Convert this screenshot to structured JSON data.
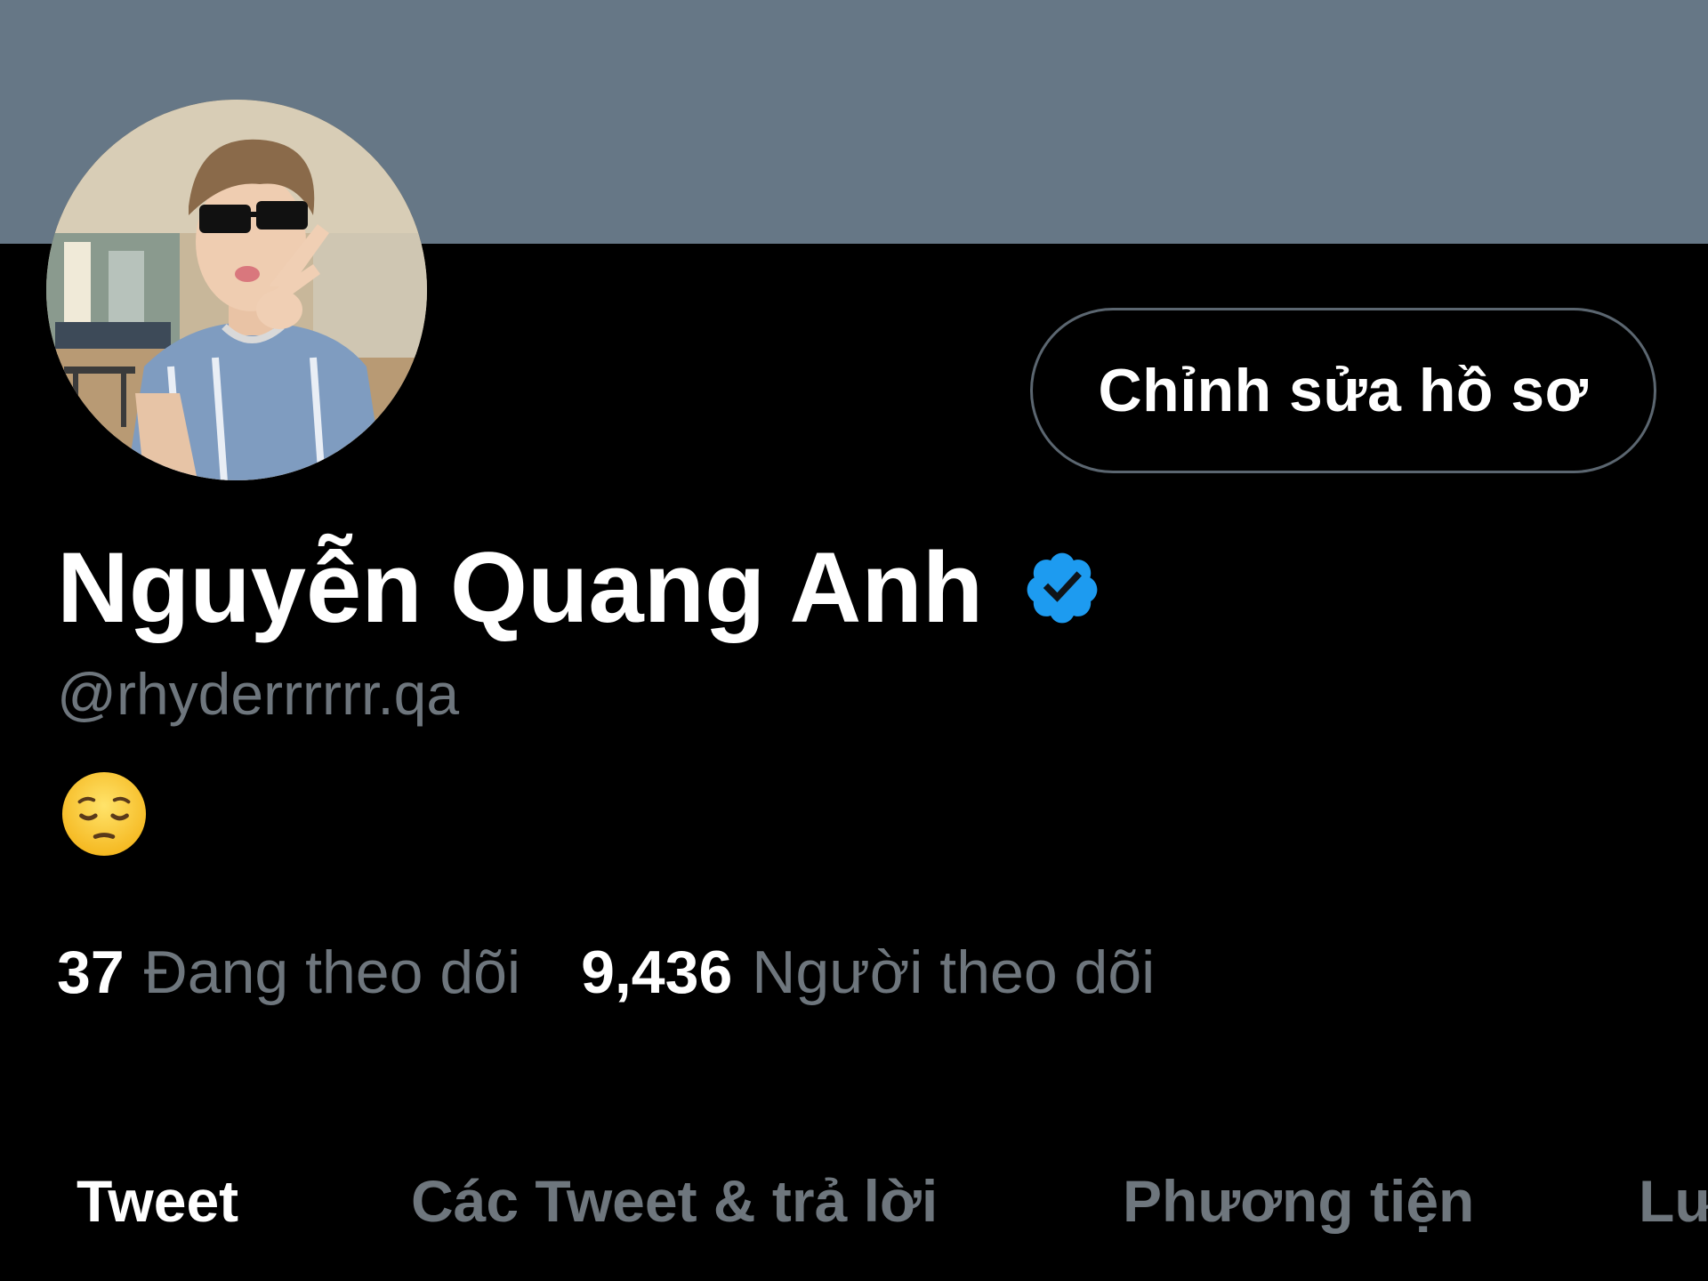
{
  "header": {
    "banner_color": "#667786"
  },
  "profile": {
    "display_name": "Nguyễn Quang Anh",
    "verified": true,
    "verified_icon": "verified-badge-icon",
    "verified_color": "#1d9bf0",
    "handle": "@rhyderrrrrr.qa",
    "bio_emoji": "😔",
    "bio_emoji_name": "pensive-face-icon",
    "edit_button_label": "Chỉnh sửa hồ sơ"
  },
  "stats": {
    "following_count": "37",
    "following_label": "Đang theo dõi",
    "followers_count": "9,436",
    "followers_label": "Người theo dõi"
  },
  "tabs": [
    {
      "label": "Tweet",
      "active": true
    },
    {
      "label": "Các Tweet & trả lời",
      "active": false
    },
    {
      "label": "Phương tiện",
      "active": false
    },
    {
      "label": "Lư",
      "active": false
    }
  ],
  "colors": {
    "background": "#000000",
    "primary_text": "#ffffff",
    "secondary_text": "#6e767d",
    "border": "#5b6670"
  }
}
